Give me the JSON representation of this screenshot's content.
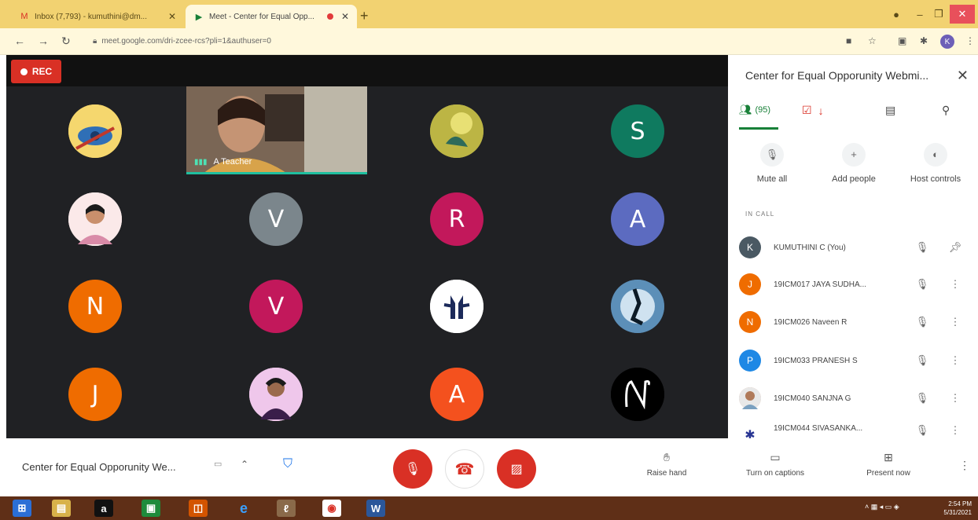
{
  "browser": {
    "tabs": [
      {
        "title": "Inbox (7,793) - kumuthini@dm...",
        "favicon": "gmail-icon"
      },
      {
        "title": "Meet - Center for Equal Opp...",
        "favicon": "meet-icon"
      }
    ],
    "url": "meet.google.com/dri-zcee-rcs?pli=1&authuser=0",
    "profile_initial": "K"
  },
  "meeting": {
    "rec_label": "REC",
    "name": "Center for Equal Opporunity We...",
    "featured_name": "A Teacher",
    "grid": [
      {
        "initial": "",
        "kind": "image",
        "color": "#e8b93a"
      },
      {
        "initial": "",
        "kind": "image",
        "color": "#9a9a55"
      },
      {
        "initial": "S",
        "kind": "letter",
        "color": "#0f7a5f"
      },
      {
        "initial": "",
        "kind": "image",
        "color": "#f3c1c1"
      },
      {
        "initial": "V",
        "kind": "letter",
        "color": "#7b868c"
      },
      {
        "initial": "R",
        "kind": "letter",
        "color": "#c2185b"
      },
      {
        "initial": "A",
        "kind": "letter",
        "color": "#5c6bc0"
      },
      {
        "initial": "N",
        "kind": "letter",
        "color": "#ef6c00"
      },
      {
        "initial": "V",
        "kind": "letter",
        "color": "#c2185b"
      },
      {
        "initial": "",
        "kind": "image",
        "color": "#ffffff"
      },
      {
        "initial": "",
        "kind": "image",
        "color": "#3b5a78"
      },
      {
        "initial": "J",
        "kind": "letter",
        "color": "#ef6c00"
      },
      {
        "initial": "",
        "kind": "image",
        "color": "#e5b7e0"
      },
      {
        "initial": "A",
        "kind": "letter",
        "color": "#f4511e"
      },
      {
        "initial": "",
        "kind": "image",
        "color": "#000000"
      }
    ]
  },
  "side_panel": {
    "title": "Center for Equal Opporunity Webmi...",
    "people_count": "(95)",
    "actions": {
      "mute_all": "Mute all",
      "add_people": "Add people",
      "host_controls": "Host controls"
    },
    "in_call_label": "IN CALL",
    "participants": [
      {
        "name": "KUMUTHINI C (You)",
        "initial": "K",
        "color": "#4a5963"
      },
      {
        "name": "19ICM017 JAYA SUDHA...",
        "initial": "J",
        "color": "#ef6c00"
      },
      {
        "name": "19ICM026 Naveen R",
        "initial": "N",
        "color": "#ef6c00"
      },
      {
        "name": "19ICM033 PRANESH S",
        "initial": "P",
        "color": "#1e88e5"
      },
      {
        "name": "19ICM040 SANJNA G",
        "initial": "",
        "color": "#d9a48a"
      },
      {
        "name": "19ICM044 SIVASANKA...",
        "initial": "",
        "color": "#283593"
      }
    ]
  },
  "controls": {
    "raise_hand": "Raise hand",
    "captions": "Turn on captions",
    "present": "Present now"
  },
  "taskbar": {
    "time": "2:54 PM",
    "date": "5/31/2021"
  },
  "colors": {
    "tabbar": "#f2d271",
    "meet_bg": "#202124",
    "accent_green": "#188038",
    "end_red": "#d93025",
    "taskbar": "#5f2f17"
  }
}
